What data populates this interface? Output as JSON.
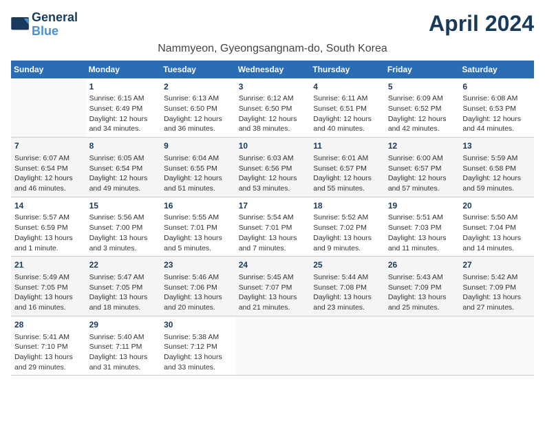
{
  "logo": {
    "line1": "General",
    "line2": "Blue"
  },
  "title": "April 2024",
  "location": "Nammyeon, Gyeongsangnam-do, South Korea",
  "weekdays": [
    "Sunday",
    "Monday",
    "Tuesday",
    "Wednesday",
    "Thursday",
    "Friday",
    "Saturday"
  ],
  "weeks": [
    [
      {
        "day": "",
        "text": ""
      },
      {
        "day": "1",
        "text": "Sunrise: 6:15 AM\nSunset: 6:49 PM\nDaylight: 12 hours\nand 34 minutes."
      },
      {
        "day": "2",
        "text": "Sunrise: 6:13 AM\nSunset: 6:50 PM\nDaylight: 12 hours\nand 36 minutes."
      },
      {
        "day": "3",
        "text": "Sunrise: 6:12 AM\nSunset: 6:50 PM\nDaylight: 12 hours\nand 38 minutes."
      },
      {
        "day": "4",
        "text": "Sunrise: 6:11 AM\nSunset: 6:51 PM\nDaylight: 12 hours\nand 40 minutes."
      },
      {
        "day": "5",
        "text": "Sunrise: 6:09 AM\nSunset: 6:52 PM\nDaylight: 12 hours\nand 42 minutes."
      },
      {
        "day": "6",
        "text": "Sunrise: 6:08 AM\nSunset: 6:53 PM\nDaylight: 12 hours\nand 44 minutes."
      }
    ],
    [
      {
        "day": "7",
        "text": "Sunrise: 6:07 AM\nSunset: 6:54 PM\nDaylight: 12 hours\nand 46 minutes."
      },
      {
        "day": "8",
        "text": "Sunrise: 6:05 AM\nSunset: 6:54 PM\nDaylight: 12 hours\nand 49 minutes."
      },
      {
        "day": "9",
        "text": "Sunrise: 6:04 AM\nSunset: 6:55 PM\nDaylight: 12 hours\nand 51 minutes."
      },
      {
        "day": "10",
        "text": "Sunrise: 6:03 AM\nSunset: 6:56 PM\nDaylight: 12 hours\nand 53 minutes."
      },
      {
        "day": "11",
        "text": "Sunrise: 6:01 AM\nSunset: 6:57 PM\nDaylight: 12 hours\nand 55 minutes."
      },
      {
        "day": "12",
        "text": "Sunrise: 6:00 AM\nSunset: 6:57 PM\nDaylight: 12 hours\nand 57 minutes."
      },
      {
        "day": "13",
        "text": "Sunrise: 5:59 AM\nSunset: 6:58 PM\nDaylight: 12 hours\nand 59 minutes."
      }
    ],
    [
      {
        "day": "14",
        "text": "Sunrise: 5:57 AM\nSunset: 6:59 PM\nDaylight: 13 hours\nand 1 minute."
      },
      {
        "day": "15",
        "text": "Sunrise: 5:56 AM\nSunset: 7:00 PM\nDaylight: 13 hours\nand 3 minutes."
      },
      {
        "day": "16",
        "text": "Sunrise: 5:55 AM\nSunset: 7:01 PM\nDaylight: 13 hours\nand 5 minutes."
      },
      {
        "day": "17",
        "text": "Sunrise: 5:54 AM\nSunset: 7:01 PM\nDaylight: 13 hours\nand 7 minutes."
      },
      {
        "day": "18",
        "text": "Sunrise: 5:52 AM\nSunset: 7:02 PM\nDaylight: 13 hours\nand 9 minutes."
      },
      {
        "day": "19",
        "text": "Sunrise: 5:51 AM\nSunset: 7:03 PM\nDaylight: 13 hours\nand 11 minutes."
      },
      {
        "day": "20",
        "text": "Sunrise: 5:50 AM\nSunset: 7:04 PM\nDaylight: 13 hours\nand 14 minutes."
      }
    ],
    [
      {
        "day": "21",
        "text": "Sunrise: 5:49 AM\nSunset: 7:05 PM\nDaylight: 13 hours\nand 16 minutes."
      },
      {
        "day": "22",
        "text": "Sunrise: 5:47 AM\nSunset: 7:05 PM\nDaylight: 13 hours\nand 18 minutes."
      },
      {
        "day": "23",
        "text": "Sunrise: 5:46 AM\nSunset: 7:06 PM\nDaylight: 13 hours\nand 20 minutes."
      },
      {
        "day": "24",
        "text": "Sunrise: 5:45 AM\nSunset: 7:07 PM\nDaylight: 13 hours\nand 21 minutes."
      },
      {
        "day": "25",
        "text": "Sunrise: 5:44 AM\nSunset: 7:08 PM\nDaylight: 13 hours\nand 23 minutes."
      },
      {
        "day": "26",
        "text": "Sunrise: 5:43 AM\nSunset: 7:09 PM\nDaylight: 13 hours\nand 25 minutes."
      },
      {
        "day": "27",
        "text": "Sunrise: 5:42 AM\nSunset: 7:09 PM\nDaylight: 13 hours\nand 27 minutes."
      }
    ],
    [
      {
        "day": "28",
        "text": "Sunrise: 5:41 AM\nSunset: 7:10 PM\nDaylight: 13 hours\nand 29 minutes."
      },
      {
        "day": "29",
        "text": "Sunrise: 5:40 AM\nSunset: 7:11 PM\nDaylight: 13 hours\nand 31 minutes."
      },
      {
        "day": "30",
        "text": "Sunrise: 5:38 AM\nSunset: 7:12 PM\nDaylight: 13 hours\nand 33 minutes."
      },
      {
        "day": "",
        "text": ""
      },
      {
        "day": "",
        "text": ""
      },
      {
        "day": "",
        "text": ""
      },
      {
        "day": "",
        "text": ""
      }
    ]
  ]
}
